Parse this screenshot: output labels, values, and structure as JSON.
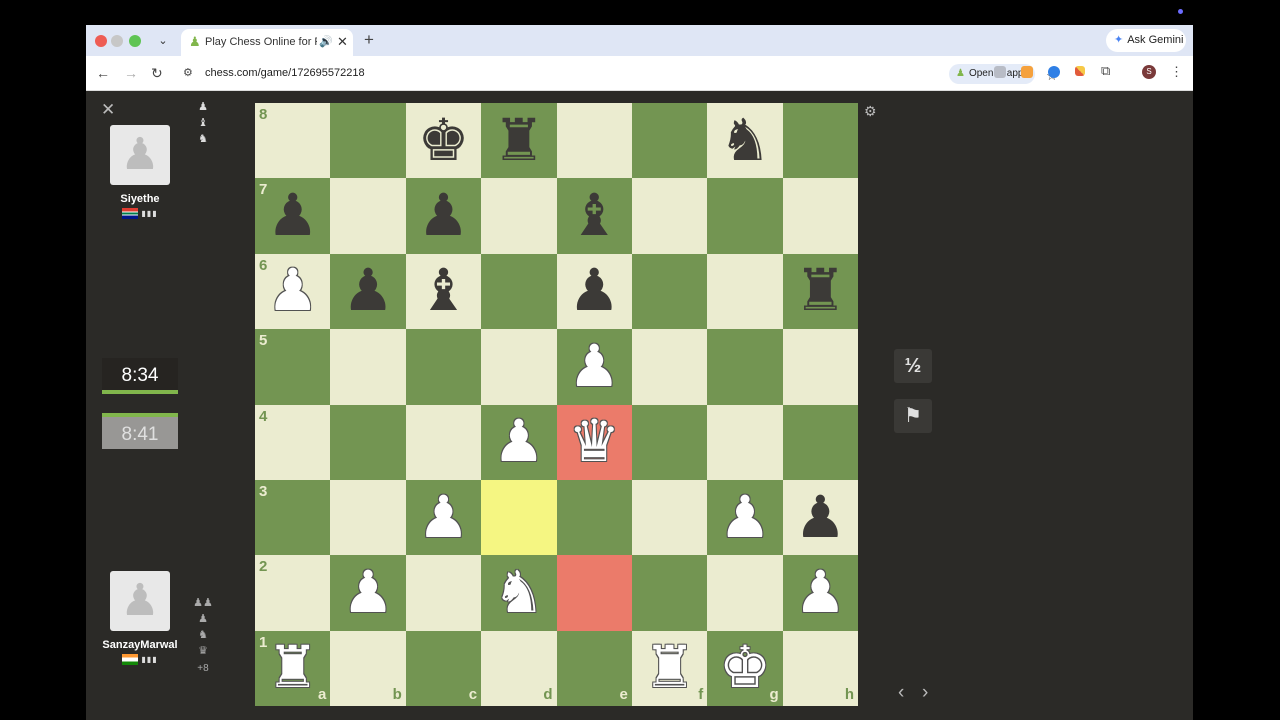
{
  "browser": {
    "tab_title": "Play Chess Online for FREE",
    "tab_favicon": "♟",
    "tab_audio_icon": "🔊",
    "tab_close": "✕",
    "new_tab": "+",
    "tab_dropdown": "⌄",
    "gemini_label": "Ask Gemini",
    "gemini_icon": "✦",
    "url": "chess.com/game/172695572218",
    "open_in_app": "Open in app",
    "back": "←",
    "forward": "→",
    "reload": "↻",
    "site_info_icon": "⚙",
    "bookmark_star": "☆",
    "extensions_icon": "⧉",
    "profile_initial": "S",
    "menu": "⋮"
  },
  "game": {
    "close": "✕",
    "settings_icon": "⚙",
    "top_player": {
      "name": "Siyethe",
      "flag": "ZA",
      "avatar_glyph": "♟",
      "captured": [
        "♟",
        "♝",
        "♞"
      ],
      "clock": "8:34"
    },
    "bottom_player": {
      "name": "SanzayMarwal",
      "flag": "IN",
      "avatar_glyph": "♟",
      "captured": [
        "♟♟",
        "♟",
        "♞",
        "♛"
      ],
      "material_diff": "+8",
      "clock": "8:41"
    },
    "controls": {
      "draw": "½",
      "resign": "⚑",
      "prev": "‹",
      "next": "›"
    },
    "ranks": [
      "8",
      "7",
      "6",
      "5",
      "4",
      "3",
      "2",
      "1"
    ],
    "files": [
      "a",
      "b",
      "c",
      "d",
      "e",
      "f",
      "g",
      "h"
    ],
    "highlights": {
      "yellow": [
        "d3"
      ],
      "red": [
        "e4",
        "e2"
      ]
    },
    "position": {
      "c8": "bK",
      "d8": "bR",
      "g8": "bN",
      "a7": "bP",
      "c7": "bP",
      "e7": "bB",
      "a6": "wP",
      "b6": "bP",
      "c6": "bB",
      "e6": "bP",
      "h6": "bR",
      "e5": "wP",
      "d4": "wP",
      "e4": "wQ",
      "c3": "wP",
      "g3": "wP",
      "h3": "bP",
      "b2": "wP",
      "d2": "wN",
      "h2": "wP",
      "a1": "wR",
      "f1": "wR",
      "g1": "wK"
    }
  },
  "colors": {
    "light_square": "#ebecd0",
    "dark_square": "#739552",
    "last_move_yellow": "#f5f682",
    "check_red": "#eb7b6a",
    "background": "#2b2a27"
  }
}
